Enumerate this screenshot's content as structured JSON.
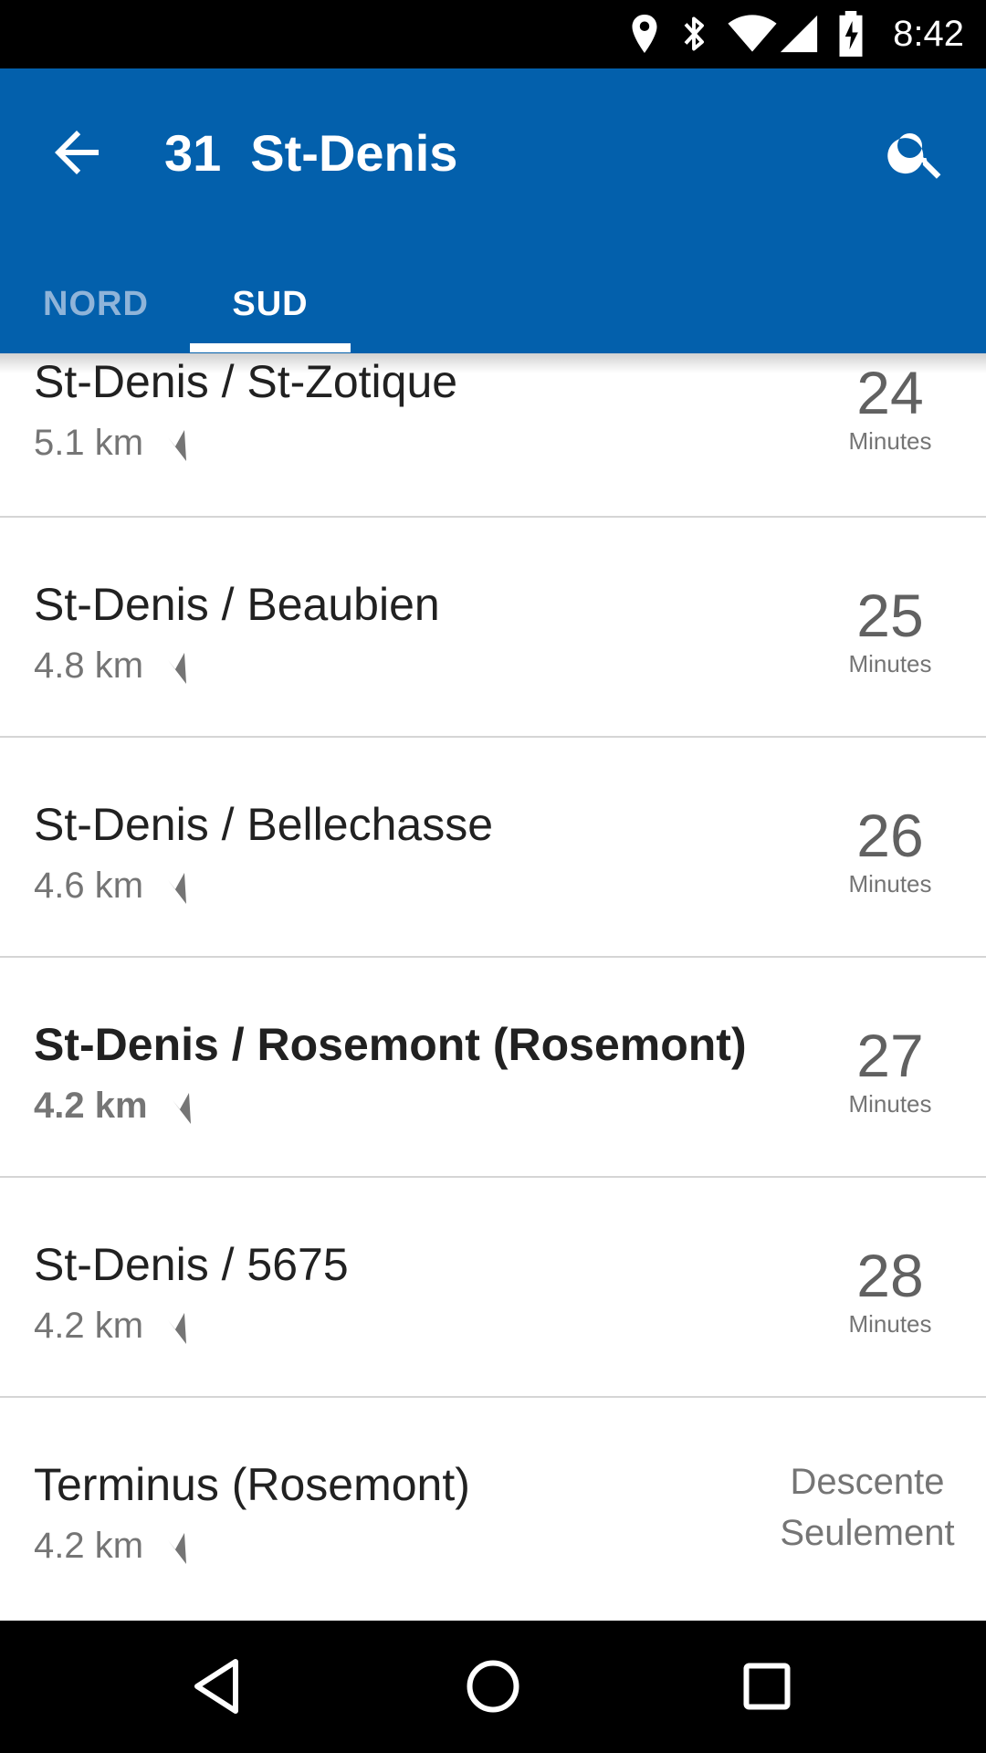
{
  "status_bar": {
    "time": "8:42",
    "icons": [
      "location-icon",
      "bluetooth-icon",
      "wifi-icon",
      "cell-signal-icon",
      "battery-charging-icon"
    ]
  },
  "app_bar": {
    "route_number": "31",
    "route_name": "St-Denis",
    "back_icon": "arrow-back-icon",
    "search_icon": "search-icon",
    "tabs": [
      {
        "label": "NORD",
        "selected": false
      },
      {
        "label": "SUD",
        "selected": true
      }
    ]
  },
  "stops": [
    {
      "name": "St-Denis / St-Zotique",
      "distance": "5.1 km",
      "eta_value": "24",
      "eta_unit": "Minutes",
      "bold": false
    },
    {
      "name": "St-Denis / Beaubien",
      "distance": "4.8 km",
      "eta_value": "25",
      "eta_unit": "Minutes",
      "bold": false
    },
    {
      "name": "St-Denis / Bellechasse",
      "distance": "4.6 km",
      "eta_value": "26",
      "eta_unit": "Minutes",
      "bold": false
    },
    {
      "name": "St-Denis / Rosemont (Rosemont)",
      "distance": "4.2 km",
      "eta_value": "27",
      "eta_unit": "Minutes",
      "bold": true
    },
    {
      "name": "St-Denis / 5675",
      "distance": "4.2 km",
      "eta_value": "28",
      "eta_unit": "Minutes",
      "bold": false
    },
    {
      "name": "Terminus (Rosemont)",
      "distance": "4.2 km",
      "eta_line1": "Descente",
      "eta_line2": "Seulement",
      "bold": false
    }
  ],
  "nav_bar": {
    "icons": [
      "back-triangle-icon",
      "home-circle-icon",
      "recents-square-icon"
    ]
  },
  "colors": {
    "app_bar": "#0360ac",
    "tab_inactive": "#8fb4d9",
    "text_primary": "#212121",
    "text_secondary": "#757575"
  }
}
